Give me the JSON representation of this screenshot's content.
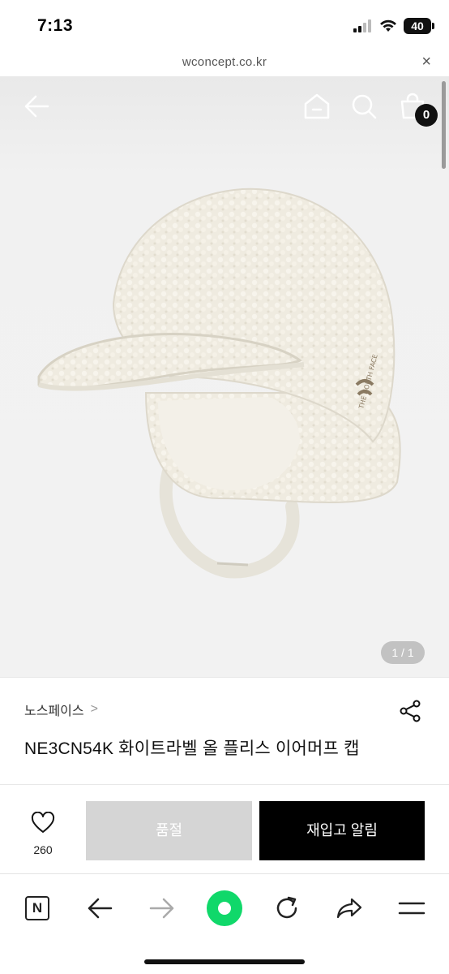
{
  "status_bar": {
    "time": "7:13",
    "battery": "40"
  },
  "url_bar": {
    "url": "wconcept.co.kr",
    "close": "×"
  },
  "product_nav": {
    "cart_count": "0"
  },
  "image": {
    "counter": "1 / 1",
    "logo_text": "THE NORTH FACE"
  },
  "product": {
    "brand": "노스페이스",
    "brand_chevron": ">",
    "title": "NE3CN54K 화이트라벨 올 플리스 이어머프 캡"
  },
  "actions": {
    "wish_count": "260",
    "soldout_label": "품절",
    "restock_label": "재입고 알림"
  },
  "toolbar": {
    "n_label": "N"
  },
  "colors": {
    "accent_green": "#10d86a",
    "soldout_gray": "#d5d5d5",
    "primary_black": "#000000"
  }
}
